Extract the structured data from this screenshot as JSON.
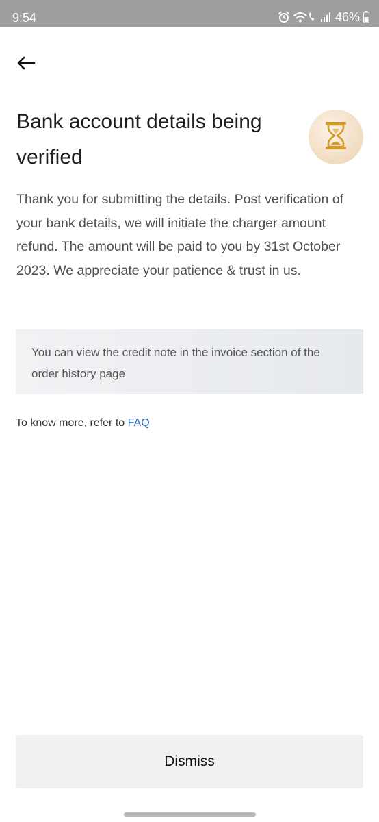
{
  "status_bar": {
    "time": "9:54",
    "battery_percent": "46%",
    "icons": [
      "alarm-icon",
      "wifi-calling-icon",
      "signal-icon",
      "battery-icon"
    ]
  },
  "header": {
    "back_icon": "arrow-left-icon"
  },
  "main": {
    "title": "Bank account details being verified",
    "status_icon": "hourglass-icon",
    "message": "Thank you for submitting the details. Post verification of your bank details, we will initiate the charger amount refund. The amount will be paid to you by 31st October 2023. We appreciate your patience & trust in us.",
    "note": "You can view the credit note in the invoice section of the order history page",
    "faq_prefix": "To know more, refer to ",
    "faq_link": "FAQ"
  },
  "footer": {
    "dismiss_label": "Dismiss"
  },
  "colors": {
    "link": "#2766c5",
    "hourglass": "#d49a2a",
    "badge_bg": "#f3e1c9",
    "status_bar_bg": "#9e9e9e"
  }
}
